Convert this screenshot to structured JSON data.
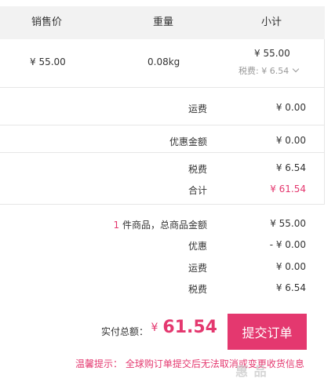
{
  "table": {
    "headers": [
      "销售价",
      "重量",
      "小计"
    ]
  },
  "item": {
    "price": "¥ 55.00",
    "weight": "0.08kg",
    "subtotal": "¥ 55.00",
    "tax_label": "税费: ¥ 6.54"
  },
  "fees": {
    "shipping_label": "运费",
    "shipping_value": "¥ 0.00",
    "discount_label": "优惠金额",
    "discount_value": "¥ 0.00",
    "tax_label": "税费",
    "tax_value": "¥ 6.54",
    "total_label": "合计",
    "total_value": "¥ 61.54"
  },
  "summary": {
    "count": "1",
    "count_label": " 件商品，总商品金额",
    "goods_value": "¥ 55.00",
    "discount_label": "优惠",
    "discount_value": "- ¥ 0.00",
    "shipping_label": "运费",
    "shipping_value": "¥ 0.00",
    "tax_label": "税费",
    "tax_value": "¥ 6.54"
  },
  "checkout": {
    "total_label": "实付总额：",
    "currency": "¥",
    "total_amount": "61.54",
    "submit_label": "提交订单"
  },
  "tip": "温馨提示：  全球购订单提交后无法取消或变更收货信息",
  "watermark": "惠 品 huim.com",
  "colors": {
    "accent": "#e4386f",
    "header_bg": "#f2f2f2",
    "border": "#e6e6e6"
  }
}
